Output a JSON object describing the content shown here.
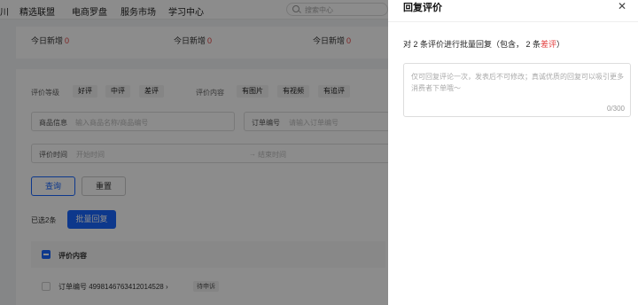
{
  "nav": {
    "items": [
      "川",
      "精选联盟",
      "电商罗盘",
      "服务市场",
      "学习中心"
    ],
    "search_placeholder": "搜索中心"
  },
  "stats": [
    {
      "label": "今日新增",
      "value": "0"
    },
    {
      "label": "今日新增",
      "value": "0"
    },
    {
      "label": "今日新增",
      "value": "0"
    }
  ],
  "filters": {
    "rating_label": "评价等级",
    "ratings": [
      "好评",
      "中评",
      "差评"
    ],
    "content_label": "评价内容",
    "contents": [
      "有图片",
      "有视频",
      "有追评"
    ],
    "product_label": "商品信息",
    "product_placeholder": "输入商品名称/商品编号",
    "order_label": "订单编号",
    "order_placeholder": "请输入订单编号",
    "time_label": "评价时间",
    "start_placeholder": "开始时间",
    "end_placeholder": "结束时间"
  },
  "actions": {
    "query": "查询",
    "reset": "重置",
    "selected": "已选2条",
    "batch_reply": "批量回复"
  },
  "table": {
    "header": "评价内容",
    "rows": [
      {
        "order_text": "订单编号 4998146763412014528 ›",
        "badge": "待申诉"
      }
    ]
  },
  "drawer": {
    "title": "回复评价",
    "close_icon": "close-icon",
    "info_prefix": "对 2 条评价进行批量回复（包含， 2 条",
    "info_bad": "差评",
    "info_suffix": "）",
    "placeholder": "仅可回复评论一次，发表后不可修改；真诚优质的回复可以吸引更多消费者下单哦～",
    "counter": "0/300"
  },
  "colors": {
    "accent": "#1966ff",
    "danger": "#e23a3a"
  }
}
